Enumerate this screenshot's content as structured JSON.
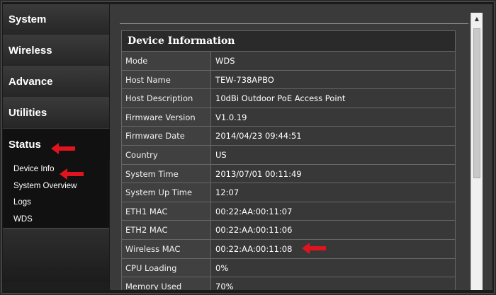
{
  "sidebar": {
    "items": [
      {
        "label": "System"
      },
      {
        "label": "Wireless"
      },
      {
        "label": "Advance"
      },
      {
        "label": "Utilities"
      },
      {
        "label": "Status"
      }
    ],
    "sub_items": [
      {
        "label": "Device Info"
      },
      {
        "label": "System Overview"
      },
      {
        "label": "Logs"
      },
      {
        "label": "WDS"
      }
    ]
  },
  "panel": {
    "title": "Device Information",
    "rows": [
      {
        "label": "Mode",
        "value": "WDS"
      },
      {
        "label": "Host Name",
        "value": "TEW-738APBO"
      },
      {
        "label": "Host Description",
        "value": "10dBi Outdoor PoE Access Point"
      },
      {
        "label": "Firmware Version",
        "value": "V1.0.19"
      },
      {
        "label": "Firmware Date",
        "value": "2014/04/23 09:44:51"
      },
      {
        "label": "Country",
        "value": "US"
      },
      {
        "label": "System Time",
        "value": "2013/07/01 00:11:49"
      },
      {
        "label": "System Up Time",
        "value": "12:07"
      },
      {
        "label": "ETH1 MAC",
        "value": "00:22:AA:00:11:07"
      },
      {
        "label": "ETH2 MAC",
        "value": "00:22:AA:00:11:06"
      },
      {
        "label": "Wireless MAC",
        "value": "00:22:AA:00:11:08"
      },
      {
        "label": "CPU Loading",
        "value": "0%"
      },
      {
        "label": "Memory Used",
        "value": "70%"
      }
    ]
  },
  "colors": {
    "annotation_arrow": "#e0141e"
  }
}
